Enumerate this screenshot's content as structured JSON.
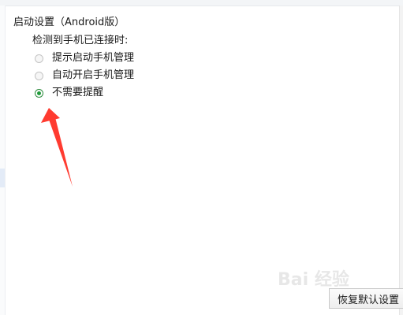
{
  "startup_settings": {
    "title": "启动设置（Android版）",
    "detect_label": "检测到手机已连接时:",
    "options": [
      {
        "label": "提示启动手机管理",
        "checked": false
      },
      {
        "label": "自动开启手机管理",
        "checked": false
      },
      {
        "label": "不需要提醒",
        "checked": true
      }
    ]
  },
  "footer": {
    "restore_defaults_label": "恢复默认设置"
  },
  "watermark": {
    "text": "Bai 经验"
  },
  "colors": {
    "annotation_arrow": "#ff3b30",
    "radio_checked": "#1f9a3a"
  }
}
